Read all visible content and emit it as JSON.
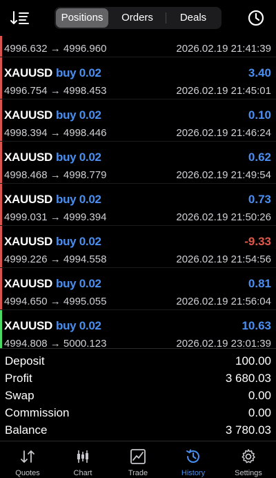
{
  "header": {
    "tabs": [
      {
        "label": "Positions",
        "active": true
      },
      {
        "label": "Orders",
        "active": false
      },
      {
        "label": "Deals",
        "active": false
      }
    ],
    "sort_icon": "sort-icon",
    "history_icon": "clock-icon"
  },
  "partial_row": {
    "prices": "4996.632 → 4996.960",
    "time": "2026.02.19 21:41:39"
  },
  "deals": [
    {
      "symbol": "XAUUSD",
      "side": "buy 0.02",
      "profit": "3.40",
      "prices": "4996.754 → 4998.453",
      "time": "2026.02.19 21:45:01"
    },
    {
      "symbol": "XAUUSD",
      "side": "buy 0.02",
      "profit": "0.10",
      "prices": "4998.394 → 4998.446",
      "time": "2026.02.19 21:46:24"
    },
    {
      "symbol": "XAUUSD",
      "side": "buy 0.02",
      "profit": "0.62",
      "prices": "4998.468 → 4998.779",
      "time": "2026.02.19 21:49:54"
    },
    {
      "symbol": "XAUUSD",
      "side": "buy 0.02",
      "profit": "0.73",
      "prices": "4999.031 → 4999.394",
      "time": "2026.02.19 21:50:26"
    },
    {
      "symbol": "XAUUSD",
      "side": "buy 0.02",
      "profit": "-9.33",
      "prices": "4999.226 → 4994.558",
      "time": "2026.02.19 21:54:56"
    },
    {
      "symbol": "XAUUSD",
      "side": "buy 0.02",
      "profit": "0.81",
      "prices": "4994.650 → 4995.055",
      "time": "2026.02.19 21:56:04"
    },
    {
      "symbol": "XAUUSD",
      "side": "buy 0.02",
      "profit": "10.63",
      "prices": "4994.808 → 5000.123",
      "time": "2026.02.19 23:01:39"
    }
  ],
  "summary": [
    {
      "label": "Deposit",
      "value": "100.00"
    },
    {
      "label": "Profit",
      "value": "3 680.03"
    },
    {
      "label": "Swap",
      "value": "0.00"
    },
    {
      "label": "Commission",
      "value": "0.00"
    },
    {
      "label": "Balance",
      "value": "3 780.03"
    }
  ],
  "tabbar": [
    {
      "label": "Quotes",
      "icon": "quotes-icon",
      "active": false
    },
    {
      "label": "Chart",
      "icon": "chart-icon",
      "active": false
    },
    {
      "label": "Trade",
      "icon": "trade-icon",
      "active": false
    },
    {
      "label": "History",
      "icon": "history-icon",
      "active": true
    },
    {
      "label": "Settings",
      "icon": "gear-icon",
      "active": false
    }
  ],
  "colors": {
    "accent": "#4a8ff0",
    "loss": "#e0584a",
    "win_bar": "#4cd964",
    "loss_bar": "#d9534f"
  }
}
